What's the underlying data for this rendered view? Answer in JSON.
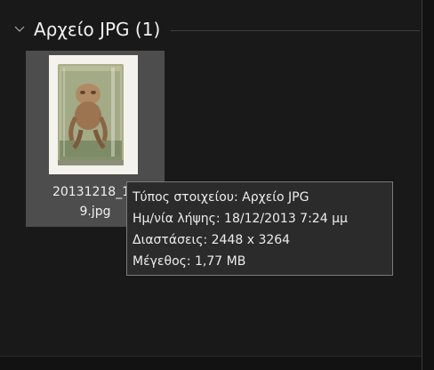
{
  "group": {
    "title": "Αρχείο JPG (1)",
    "chevron_icon": "chevron-down-icon"
  },
  "file": {
    "name_line1": "20131218_19",
    "name_line2": "9.jpg",
    "thumbnail_icon": "photo-thumbnail"
  },
  "tooltip": {
    "type_line": "Τύπος στοιχείου: Αρχείο JPG",
    "date_line": "Ημ/νία λήψης: 18/12/2013 7:24 μμ",
    "dimensions_line": "Διαστάσεις: 2448 x 3264",
    "size_line": "Μέγεθος: 1,77 MB"
  },
  "colors": {
    "background": "#191919",
    "tile_selected": "#4d4d4d",
    "tooltip_bg": "#2b2b2b",
    "tooltip_border": "#7a7a7a"
  }
}
